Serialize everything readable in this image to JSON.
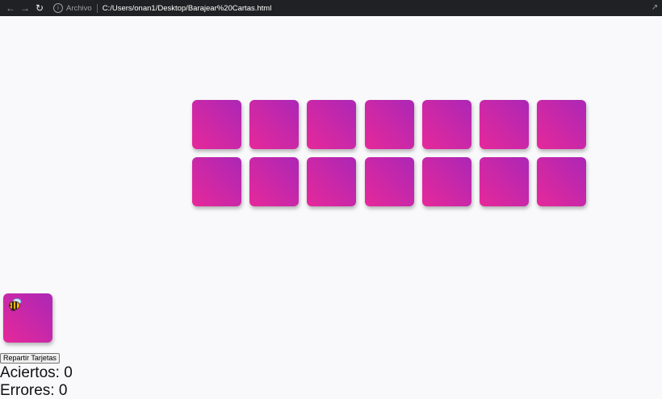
{
  "browser": {
    "back_icon": "arrow-left-icon",
    "forward_icon": "arrow-right-icon",
    "reload_icon": "reload-icon",
    "info_icon": "info-icon",
    "origin_label": "Archivo",
    "url": "C:/Users/onan1/Desktop/Barajear%20Cartas.html",
    "share_icon": "share-icon"
  },
  "board": {
    "columns": 7,
    "rows": 2,
    "card_count": 14,
    "card_gradient": [
      "#ac27b6",
      "#e6289a"
    ]
  },
  "deck": {
    "icon": "bee-icon"
  },
  "controls": {
    "deal_label": "Repartir Tarjetas"
  },
  "stats": {
    "hits_text": "Aciertos: 0",
    "misses_text": "Errores: 0"
  }
}
